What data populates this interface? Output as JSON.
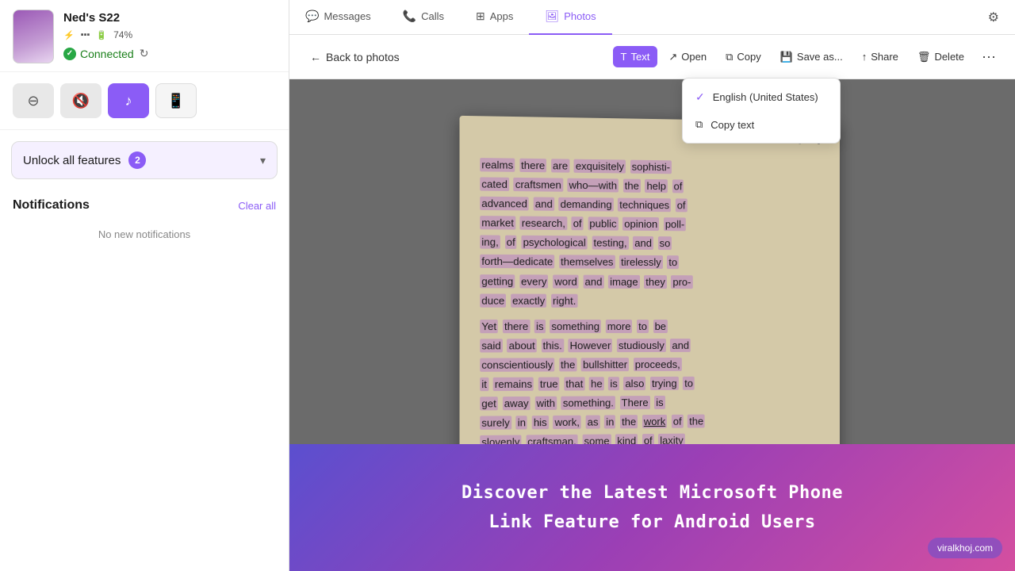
{
  "sidebar": {
    "device_name": "Ned's S22",
    "bluetooth_icon": "⚡",
    "battery_percent": "74%",
    "connected_label": "Connected",
    "action_buttons": [
      {
        "id": "mute",
        "icon": "⊖",
        "style": "gray"
      },
      {
        "id": "silent",
        "icon": "🔇",
        "style": "gray"
      },
      {
        "id": "music",
        "icon": "♪",
        "style": "purple"
      },
      {
        "id": "device",
        "icon": "📱",
        "style": "outline"
      }
    ],
    "unlock_label": "Unlock all features",
    "unlock_count": "2",
    "notifications_title": "Notifications",
    "clear_all_label": "Clear all",
    "no_notifications_label": "No new notifications"
  },
  "top_nav": {
    "tabs": [
      {
        "id": "messages",
        "label": "Messages",
        "icon": "💬",
        "active": false
      },
      {
        "id": "calls",
        "label": "Calls",
        "icon": "📞",
        "active": false
      },
      {
        "id": "apps",
        "label": "Apps",
        "icon": "⊞",
        "active": false
      },
      {
        "id": "photos",
        "label": "Photos",
        "icon": "🖼",
        "active": true
      }
    ]
  },
  "photo_toolbar": {
    "back_label": "Back to photos",
    "text_btn_label": "Text",
    "open_btn_label": "Open",
    "copy_btn_label": "Copy",
    "save_btn_label": "Save as...",
    "share_btn_label": "Share",
    "delete_btn_label": "Delete"
  },
  "dropdown": {
    "language_label": "English (United States)",
    "copy_text_label": "Copy text"
  },
  "book_text": {
    "page_number": "[ 23 ]",
    "paragraph1": "realms there are exquisitely sophisti- cated craftsmen who—with the help of advanced and demanding techniques of market research, of public opinion polling, of psychological testing, and so forth—dedicate themselves tirelessly to getting every word and image they produce exactly right.",
    "paragraph2": "Yet there is something more to be said about this. However studiously and conscientiously the bullshitter proceeds, it remains true that he is also trying to get away with something. There is surely in his work, as in the work of the slovenly craftsman, some kind of laxity"
  },
  "banner": {
    "title": "Discover the Latest Microsoft Phone",
    "subtitle": "Link Feature for Android Users",
    "watermark": "viralkhoj.com"
  }
}
